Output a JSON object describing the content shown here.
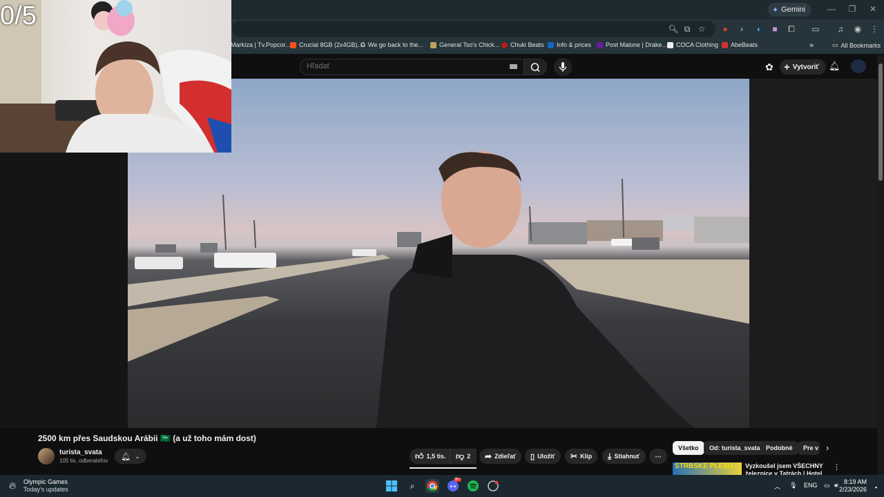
{
  "browser": {
    "gemini_label": "Gemini",
    "bookmarks": [
      {
        "label": "Markíza | Tv.Popcor...",
        "color": "#e53935"
      },
      {
        "label": "Crucial 8GB (2x4GB)...",
        "color": "#f4511e"
      },
      {
        "label": "We go back to the...",
        "color": "#ffffff"
      },
      {
        "label": "General Tso's Chick...",
        "color": "#c0a060"
      },
      {
        "label": "Chuki Beats",
        "color": "#b71c1c"
      },
      {
        "label": "Info & prices",
        "color": "#1565c0"
      },
      {
        "label": "Post Malone | Drake...",
        "color": "#6a1b9a"
      },
      {
        "label": "COCA Clothing",
        "color": "#eeeeee"
      },
      {
        "label": "AbeBeats",
        "color": "#d32f2f"
      }
    ],
    "all_bookmarks_label": "All Bookmarks"
  },
  "overlay": {
    "counter": "0/5"
  },
  "youtube": {
    "search_placeholder": "Hľadať",
    "create_label": "Vytvoriť",
    "video_title": "2500 km přes Saudskou Arábii 🇸🇦 (a už toho mám dost)",
    "channel_name": "turista_svata",
    "subscribers": "105 tis. odberateľov",
    "actions": {
      "likes": "1,5 tis.",
      "dislikes": "2",
      "share": "Zdieľať",
      "save": "Uložiť",
      "clip": "Klip",
      "download": "Stiahnuť"
    },
    "chips": [
      "Všetko",
      "Od: turista_svata",
      "Podobné",
      "Pre v"
    ],
    "recommendation": {
      "thumb_text": "ŠTRBSKÉ PLESO",
      "title": "Vyzkoušel jsem VŠECHNY železnice v Tatrách | Hotel"
    }
  },
  "taskbar": {
    "weather_title": "Olympic Games",
    "weather_sub": "Today's updates",
    "lang": "ENG",
    "time": "8:19 AM",
    "date": "2/23/2026",
    "badge": "9+"
  }
}
